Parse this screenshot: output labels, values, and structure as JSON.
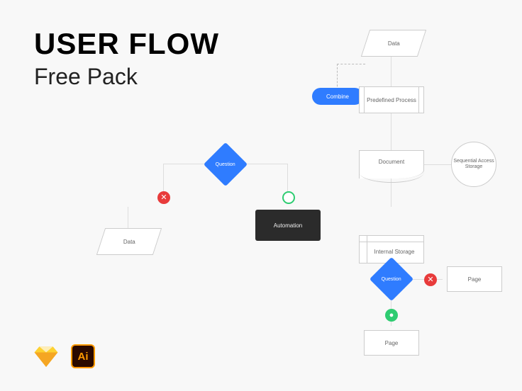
{
  "title": {
    "main": "USER FLOW",
    "sub": "Free Pack"
  },
  "nodes": {
    "data_top": "Data",
    "combine": "Combine",
    "predefined": "Predefined Process",
    "question1": "Question",
    "data_left": "Data",
    "document": "Document",
    "seq_storage": "Sequential Access Storage",
    "automation": "Automation",
    "internal_storage": "Internal Storage",
    "question2": "Question",
    "page1": "Page",
    "page2": "Page"
  },
  "footer": {
    "ai_label": "Ai"
  }
}
